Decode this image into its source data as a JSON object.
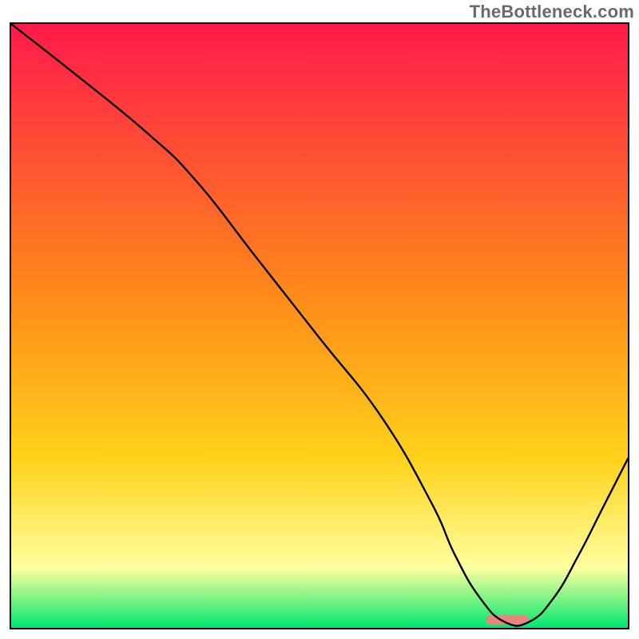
{
  "watermark": "TheBottleneck.com",
  "chart_data": {
    "type": "line",
    "title": "",
    "xlabel": "",
    "ylabel": "",
    "xlim": [
      0,
      100
    ],
    "ylim": [
      0,
      100
    ],
    "grid": false,
    "legend": false,
    "background_gradient": {
      "top_color": "#ff1a4b",
      "mid_color": "#ffd21a",
      "lower_band_color": "#ffff9e",
      "bottom_color": "#00e86f"
    },
    "series": [
      {
        "name": "bottleneck-curve",
        "color": "#000000",
        "x": [
          0,
          10,
          22,
          30,
          40,
          50,
          60,
          68,
          72,
          76,
          80,
          84,
          88,
          92,
          96,
          100
        ],
        "values": [
          100,
          92,
          82,
          74,
          61,
          48,
          35,
          21,
          12,
          5,
          1,
          1,
          5,
          12,
          20,
          28
        ]
      }
    ],
    "marker": {
      "name": "optimal-range",
      "color": "#e9857c",
      "x_start": 77,
      "x_end": 84,
      "y": 1.3,
      "height_pct": 1.6
    }
  }
}
